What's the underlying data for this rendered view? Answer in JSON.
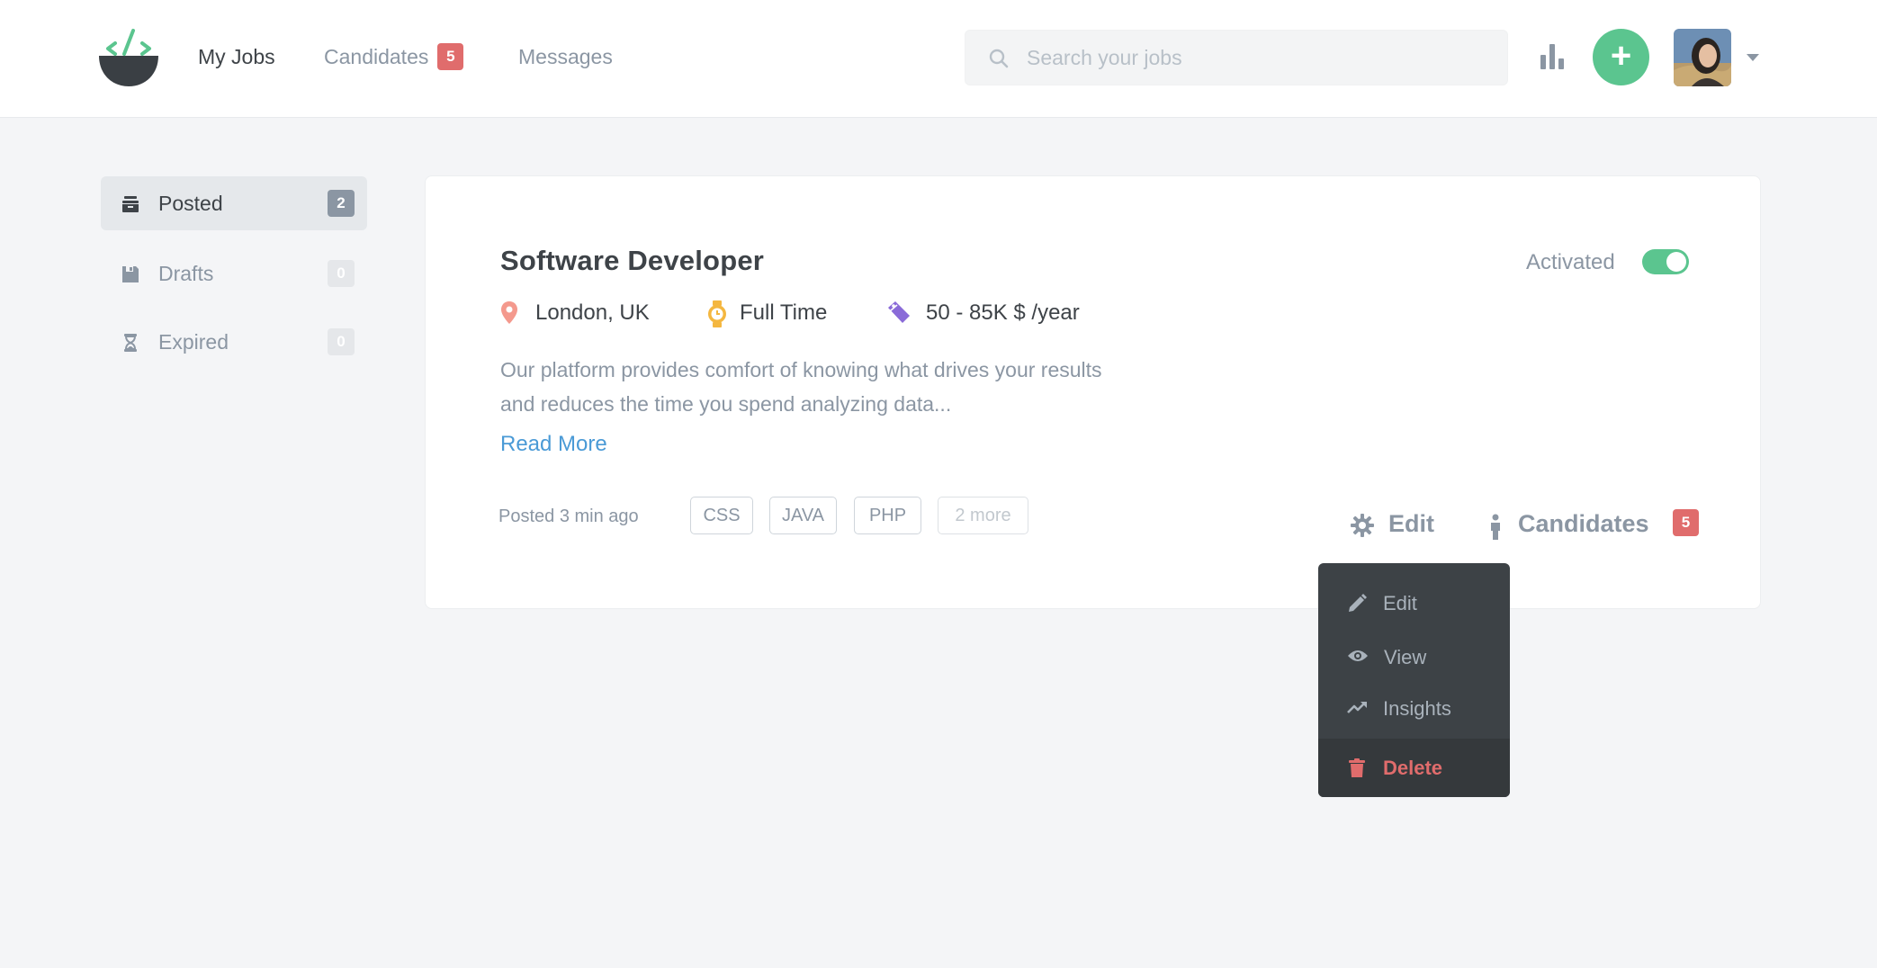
{
  "header": {
    "nav": [
      {
        "label": "My Jobs"
      },
      {
        "label": "Candidates",
        "badge": "5"
      },
      {
        "label": "Messages"
      }
    ],
    "search_placeholder": "Search your jobs",
    "add_label": "+"
  },
  "sidebar": {
    "items": [
      {
        "label": "Posted",
        "count": "2",
        "icon": "archive-icon"
      },
      {
        "label": "Drafts",
        "count": "0",
        "icon": "save-icon"
      },
      {
        "label": "Expired",
        "count": "0",
        "icon": "hourglass-icon"
      }
    ]
  },
  "job": {
    "title": "Software Developer",
    "location": "London, UK",
    "type": "Full Time",
    "salary": "50 - 85K $ /year",
    "description_line1": "Our platform provides comfort of knowing what drives your results",
    "description_line2": "and reduces the time you spend analyzing data...",
    "read_more": "Read More",
    "posted": "Posted 3 min ago",
    "tags": [
      "CSS",
      "JAVA",
      "PHP"
    ],
    "more_tags": "2 more",
    "status_label": "Activated",
    "edit_label": "Edit",
    "candidates_label": "Candidates",
    "candidates_count": "5"
  },
  "dropdown": {
    "items": [
      {
        "label": "Edit",
        "icon": "pencil-icon"
      },
      {
        "label": "View",
        "icon": "eye-icon"
      },
      {
        "label": "Insights",
        "icon": "trend-icon"
      },
      {
        "label": "Delete",
        "icon": "trash-icon"
      }
    ]
  },
  "colors": {
    "accent_green": "#5bc58f",
    "badge_red": "#e06c6c",
    "link_blue": "#4a9ad6",
    "muted_text": "#8b96a3"
  }
}
